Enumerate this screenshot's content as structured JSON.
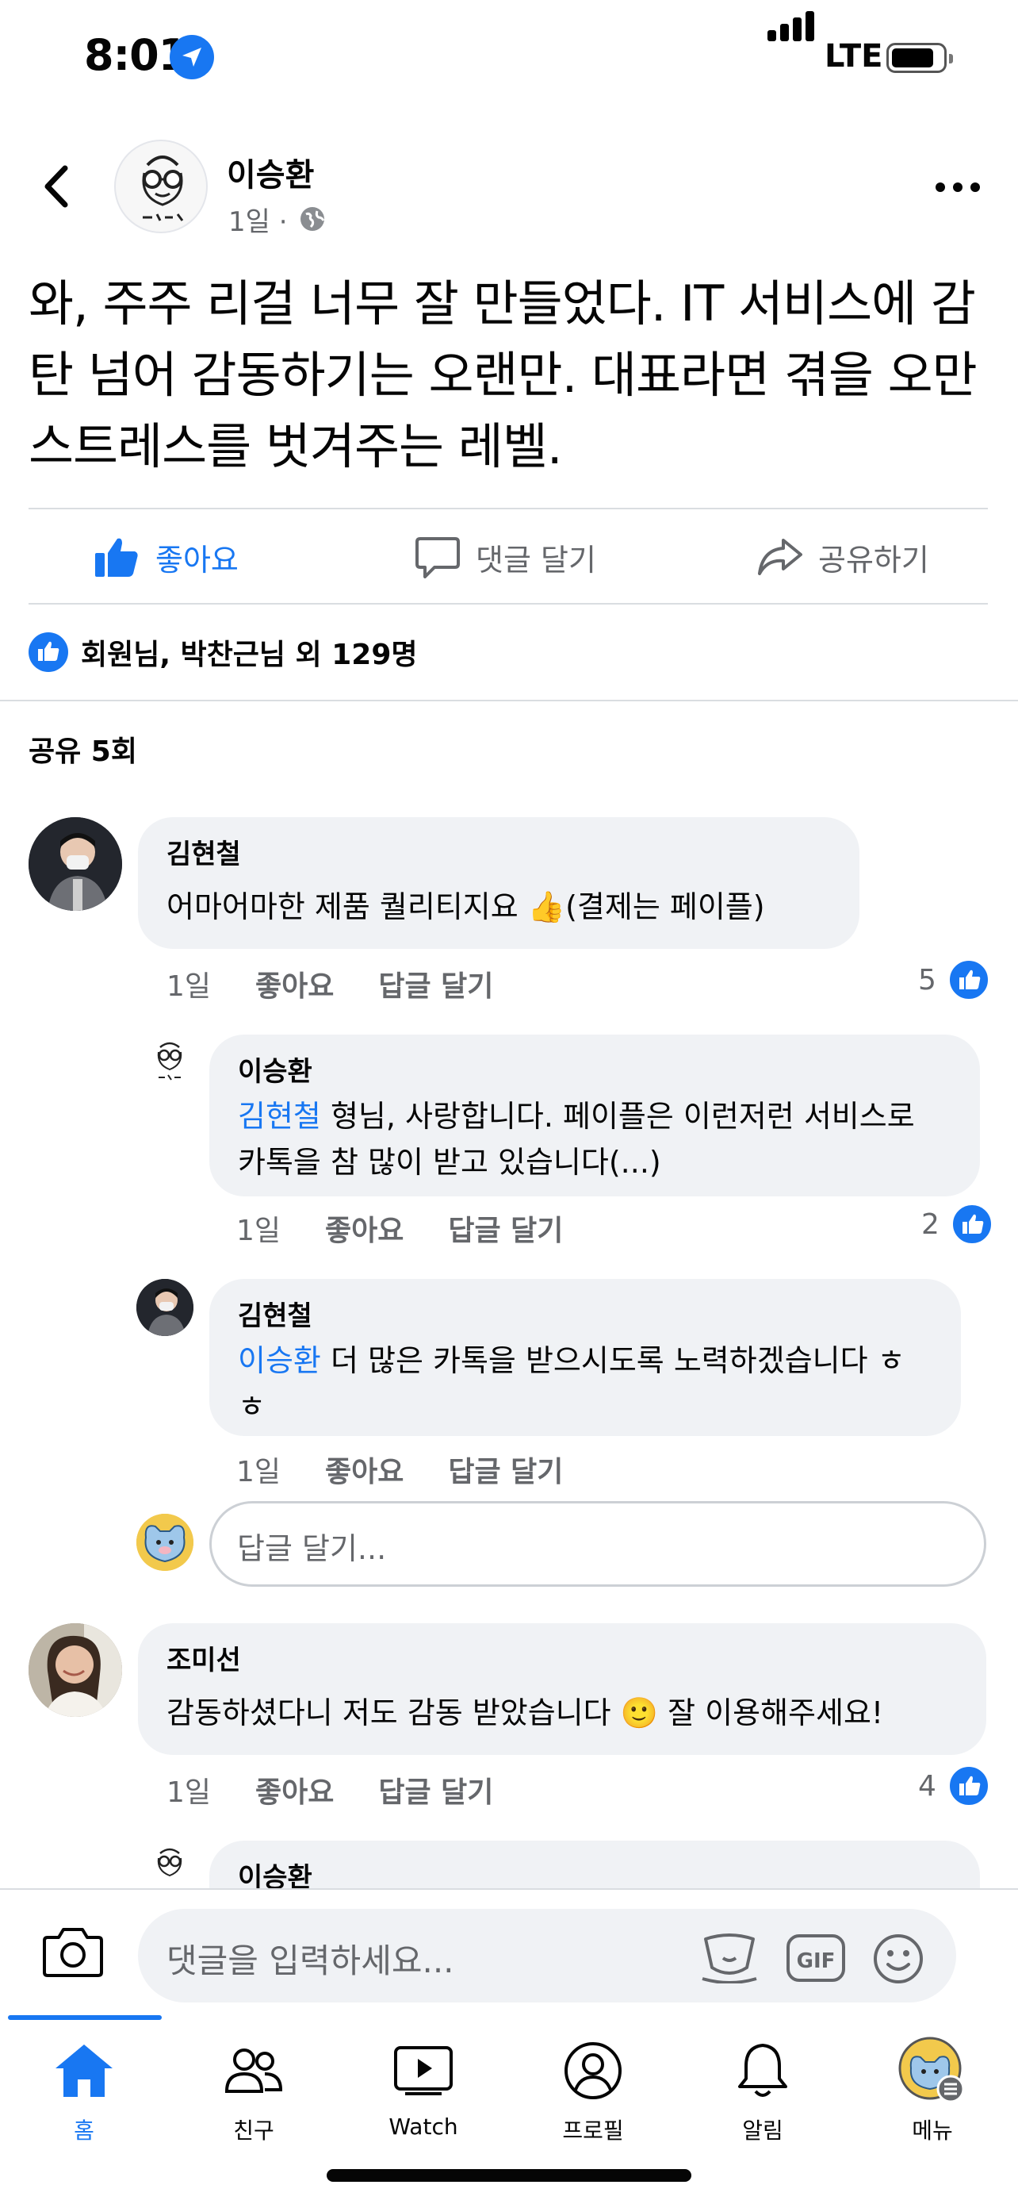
{
  "status_bar": {
    "time": "8:01",
    "network": "LTE"
  },
  "post": {
    "author": "이승환",
    "time": "1일",
    "text": "와, 주주 리걸 너무 잘 만들었다. IT 서비스에 감탄 넘어 감동하기는 오랜만. 대표라면 겪을 오만 스트레스를 벗겨주는 레벨.",
    "actions": {
      "like": "좋아요",
      "comment": "댓글 달기",
      "share": "공유하기"
    },
    "reactions_summary": "회원님, 박찬근님 외 129명",
    "shares": "공유 5회"
  },
  "comments": [
    {
      "author": "김현철",
      "text": "어마어마한 제품 퀄리티지요 👍(결제는 페이플)",
      "time": "1일",
      "like_action": "좋아요",
      "reply_action": "답글 달기",
      "likes": "5",
      "replies": [
        {
          "author": "이승환",
          "mention": "김현철",
          "text": " 형님, 사랑합니다. 페이플은 이런저런 서비스로 카톡을 참 많이 받고 있습니다(...)",
          "time": "1일",
          "like_action": "좋아요",
          "reply_action": "답글 달기",
          "likes": "2"
        },
        {
          "author": "김현철",
          "mention": "이승환",
          "text": " 더 많은 카톡을 받으시도록 노력하겠습니다 ㅎㅎ",
          "time": "1일",
          "like_action": "좋아요",
          "reply_action": "답글 달기"
        }
      ],
      "reply_placeholder": "답글 달기..."
    },
    {
      "author": "조미선",
      "text": "감동하셨다니 저도 감동 받았습니다 🙂 잘 이용해주세요!",
      "time": "1일",
      "like_action": "좋아요",
      "reply_action": "답글 달기",
      "likes": "4",
      "partial_reply_author": "이승환"
    }
  ],
  "composer": {
    "placeholder": "댓글을 입력하세요...",
    "gif_label": "GIF"
  },
  "tabs": [
    {
      "label": "홈",
      "icon": "home-icon",
      "active": true
    },
    {
      "label": "친구",
      "icon": "friends-icon"
    },
    {
      "label": "Watch",
      "icon": "watch-icon"
    },
    {
      "label": "프로필",
      "icon": "profile-icon"
    },
    {
      "label": "알림",
      "icon": "bell-icon"
    },
    {
      "label": "메뉴",
      "icon": "menu-icon"
    }
  ],
  "colors": {
    "accent": "#1877f2",
    "bubble": "#f0f2f5",
    "secondary_text": "#65676b"
  }
}
